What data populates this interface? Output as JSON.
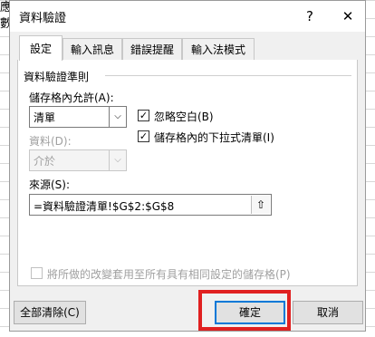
{
  "background": {
    "cell_a1": "應",
    "cell_a2": "數"
  },
  "dialog": {
    "title": "資料驗證",
    "help_glyph": "?",
    "close_glyph": "✕",
    "tabs": [
      "設定",
      "輸入訊息",
      "錯誤提醒",
      "輸入法模式"
    ],
    "criteria_group": "資料驗證準則",
    "allow_label": "儲存格內允許(A):",
    "allow_value": "清單",
    "ignore_blank_label": "忽略空白(B)",
    "ignore_blank_checked": true,
    "dropdown_label": "儲存格內的下拉式清單(I)",
    "dropdown_checked": true,
    "data_label": "資料(D):",
    "data_value": "介於",
    "source_label": "來源(S):",
    "source_value": "=資料驗證清單!$G$2:$G$8",
    "apply_all_label": "將所做的改變套用至所有具有相同設定的儲存格(P)",
    "clear_all_button": "全部清除(C)",
    "ok_button": "確定",
    "cancel_button": "取消",
    "check_glyph": "✓",
    "arrow_glyph": "⌵",
    "ref_glyph": "⇧"
  },
  "colors": {
    "highlight": "#e02020",
    "focus": "#0078d7"
  }
}
